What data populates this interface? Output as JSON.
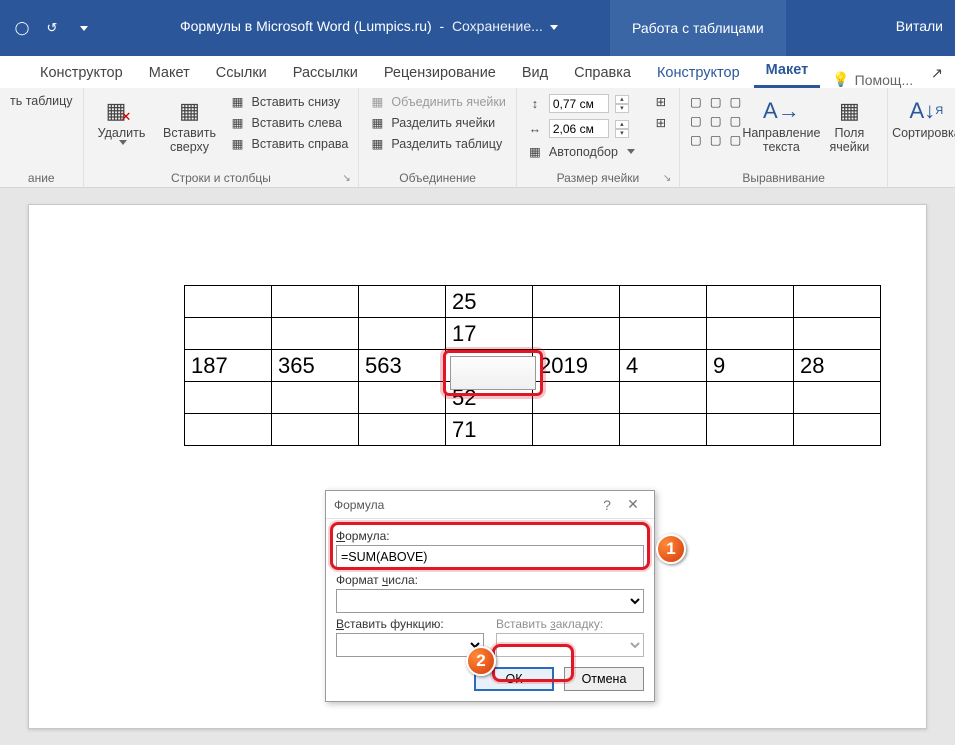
{
  "titlebar": {
    "doc_name": "Формулы в Microsoft Word (Lumpics.ru)",
    "status": "Сохранение...",
    "context_tab": "Работа с таблицами",
    "user": "Витали"
  },
  "tabs": {
    "constructor": "Конструктор",
    "layout": "Макет",
    "references": "Ссылки",
    "mailings": "Рассылки",
    "review": "Рецензирование",
    "view": "Вид",
    "help": "Справка",
    "table_constructor": "Конструктор",
    "table_layout": "Макет",
    "tell_me": "Помощ...",
    "share_icon": "↗"
  },
  "ribbon": {
    "draw_table": "ть таблицу",
    "draw_group": "ание",
    "delete": "Удалить",
    "insert_above": "Вставить\nсверху",
    "insert_below": "Вставить снизу",
    "insert_left": "Вставить слева",
    "insert_right": "Вставить справа",
    "rows_cols_group": "Строки и столбцы",
    "merge_cells": "Объединить ячейки",
    "split_cells": "Разделить ячейки",
    "split_table": "Разделить таблицу",
    "merge_group": "Объединение",
    "height_val": "0,77 см",
    "width_val": "2,06 см",
    "autofit": "Автоподбор",
    "cell_size_group": "Размер ячейки",
    "text_direction": "Направление\nтекста",
    "cell_margins": "Поля\nячейки",
    "align_group": "Выравнивание",
    "sort": "Сортировка"
  },
  "table": {
    "r1c4": "25",
    "r2c4": "17",
    "r3c1": "187",
    "r3c2": "365",
    "r3c3": "563",
    "r3c4": "",
    "r3c5": "2019",
    "r3c6": "4",
    "r3c7": "9",
    "r3c8": "28",
    "r4c4": "52",
    "r5c4": "71"
  },
  "dialog": {
    "title": "Формула",
    "formula_label": "Формула:",
    "formula_value": "=SUM(ABOVE)",
    "number_format_label": "Формат числа:",
    "insert_function_label": "Вставить функцию:",
    "insert_bookmark_label": "Вставить закладку:",
    "ok": "ОК",
    "cancel": "Отмена"
  },
  "badges": {
    "b1": "1",
    "b2": "2"
  }
}
